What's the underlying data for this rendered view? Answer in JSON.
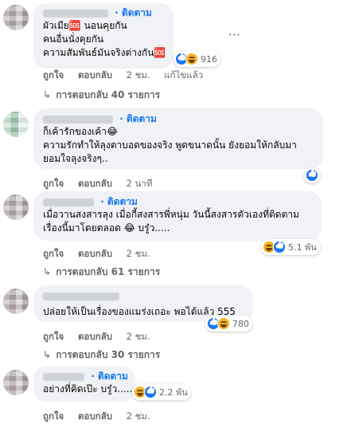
{
  "comments": [
    {
      "follow": "· ติดตาม",
      "lines": [
        "ผัวเมีย🆘 นอนคุยกัน",
        "คนอื่นนั่งคุยกัน",
        "ความสัมพันธ์มันจริงต่างกัน🆘"
      ],
      "reactions": {
        "icons": [
          "like",
          "haha"
        ],
        "count": "916"
      },
      "meta": {
        "like": "ถูกใจ",
        "reply": "ตอบกลับ",
        "time": "2 ชม.",
        "edited": "แก้ไขแล้ว"
      },
      "replies": "การตอบกลับ 40 รายการ"
    },
    {
      "follow": "· ติดตาม",
      "lines": [
        "ก็เค้ารักของเค้า😂",
        "ความรักทำให้ลุงตาบอดของจริง พูดขนาดนั้น ยังยอมให้กลับมา",
        "ยอมใจลุงจริงๆ.."
      ],
      "reactions": {
        "icons": [
          "like"
        ],
        "count": ""
      },
      "meta": {
        "like": "ถูกใจ",
        "reply": "ตอบกลับ",
        "time": "2 นาที"
      }
    },
    {
      "follow": "· ติดตาม",
      "lines": [
        "เมื่อวานสงสารลุง เมื่อกี้สงสารพี่หนุ่ม วันนี้สงสารตัวเองที่ติดตาม",
        "เรื่องนี้มาโดยตลอด 😂 บรู๋ว....."
      ],
      "reactions": {
        "icons": [
          "haha",
          "like"
        ],
        "count": "5.1 พัน"
      },
      "meta": {
        "like": "ถูกใจ",
        "reply": "ตอบกลับ",
        "time": "2 ชม."
      },
      "replies": "การตอบกลับ 61 รายการ"
    },
    {
      "follow": "",
      "lines": [
        "ปล่อยให้เป็นเรื่องของแมร่งเถอะ พอได้แล้ว 555"
      ],
      "reactions": {
        "icons": [
          "like",
          "haha"
        ],
        "count": "780"
      },
      "meta": {
        "like": "ถูกใจ",
        "reply": "ตอบกลับ",
        "time": "2 ชม."
      },
      "replies": "การตอบกลับ 30 รายการ"
    },
    {
      "follow": "· ติดตาม",
      "lines": [
        "อย่างที่คิดเป๊ะ บรู๋ว....."
      ],
      "reactions": {
        "icons": [
          "haha",
          "like"
        ],
        "count": "2.2 พัน"
      },
      "meta": {
        "like": "ถูกใจ",
        "reply": "ตอบกลับ",
        "time": "2 ชม."
      }
    }
  ],
  "colors": {
    "link": "#1877f2",
    "bubble": "#f0f2f5",
    "muted": "#65676b"
  }
}
